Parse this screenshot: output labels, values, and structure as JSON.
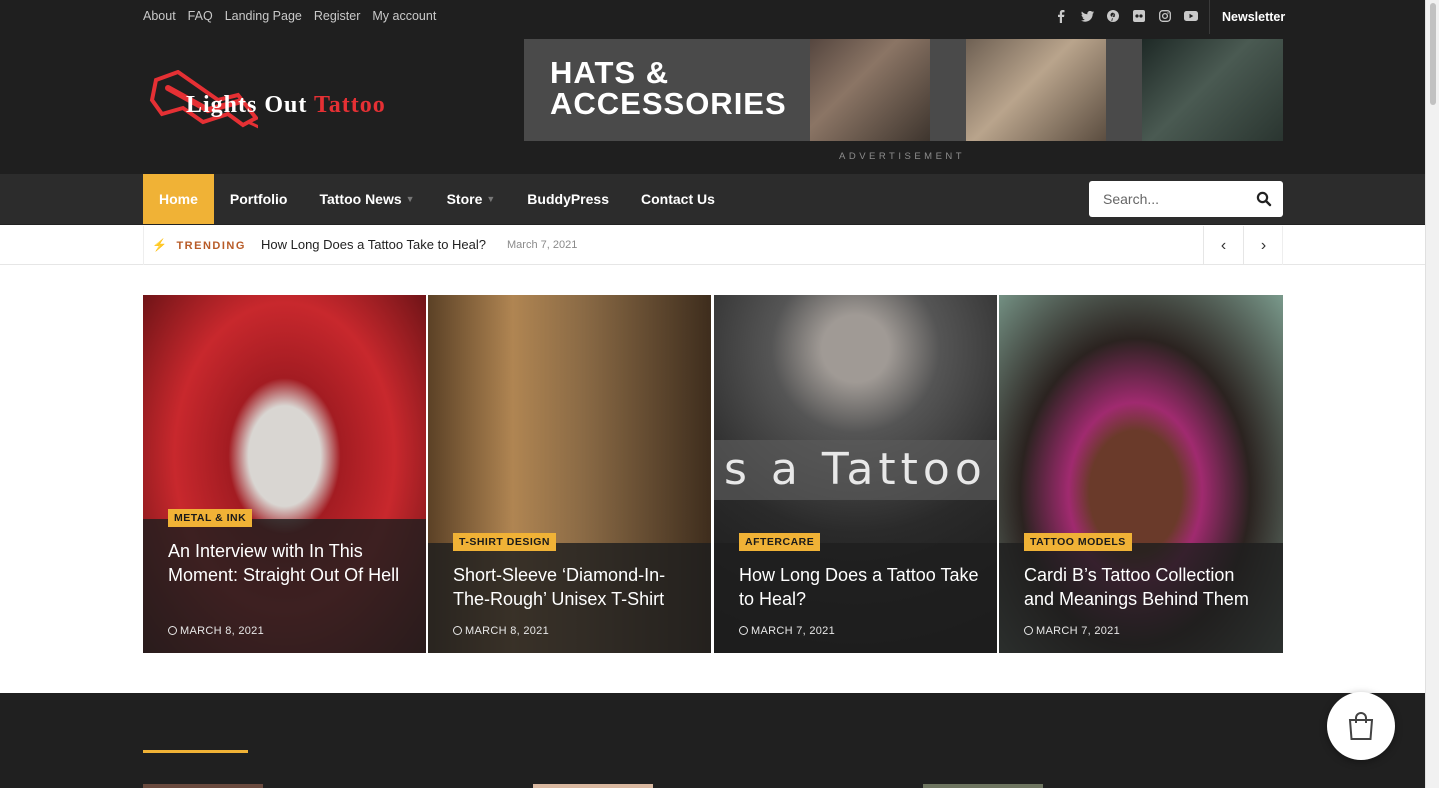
{
  "topbar": {
    "links": [
      "About",
      "FAQ",
      "Landing Page",
      "Register",
      "My account"
    ],
    "social_icons": [
      "facebook-icon",
      "twitter-icon",
      "pinterest-icon",
      "flickr-icon",
      "instagram-icon",
      "youtube-icon"
    ],
    "newsletter": "Newsletter"
  },
  "logo": {
    "word1": "Lights Out",
    "word2": "Tattoo"
  },
  "ad": {
    "title": "HATS & ACCESSORIES",
    "label": "ADVERTISEMENT"
  },
  "nav": {
    "items": [
      {
        "label": "Home",
        "active": true,
        "dropdown": false
      },
      {
        "label": "Portfolio",
        "active": false,
        "dropdown": false
      },
      {
        "label": "Tattoo News",
        "active": false,
        "dropdown": true
      },
      {
        "label": "Store",
        "active": false,
        "dropdown": true
      },
      {
        "label": "BuddyPress",
        "active": false,
        "dropdown": false
      },
      {
        "label": "Contact Us",
        "active": false,
        "dropdown": false
      }
    ],
    "search_placeholder": "Search..."
  },
  "trending": {
    "label": "TRENDING",
    "title": "How Long Does a Tattoo Take to Heal?",
    "date": "March 7, 2021"
  },
  "cards": [
    {
      "category": "METAL & INK",
      "title": "An Interview with In This Moment: Straight Out Of Hell",
      "date": "MARCH 8, 2021"
    },
    {
      "category": "T-SHIRT DESIGN",
      "title": "Short-Sleeve ‘Diamond-In-The-Rough’ Unisex T-Shirt",
      "date": "MARCH 8, 2021"
    },
    {
      "category": "AFTERCARE",
      "title": "How Long Does a Tattoo Take to Heal?",
      "date": "MARCH 7, 2021",
      "image_text": "s a Tattoo"
    },
    {
      "category": "TATTOO MODELS",
      "title": "Cardi B’s Tattoo Collection and Meanings Behind Them",
      "date": "MARCH 7, 2021"
    }
  ],
  "colors": {
    "accent": "#f0b236",
    "dark": "#1f1f1f",
    "nav": "#2c2c2c",
    "brand_red": "#e53034"
  }
}
